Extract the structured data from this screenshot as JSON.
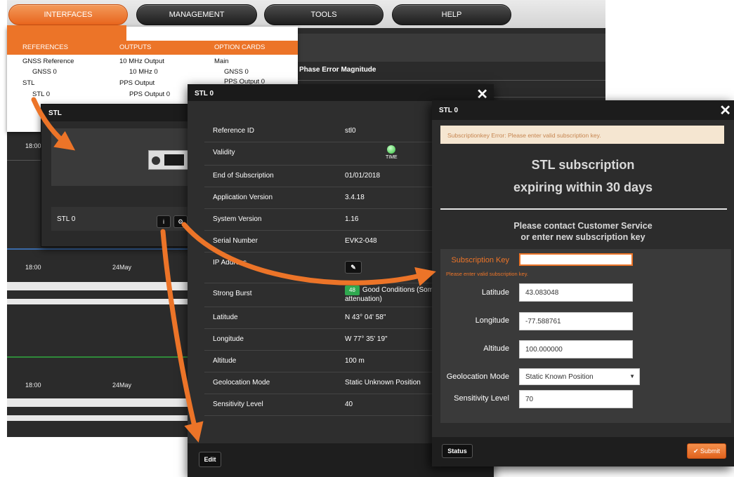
{
  "nav": {
    "items": [
      "INTERFACES",
      "MANAGEMENT",
      "TOOLS",
      "HELP"
    ]
  },
  "bg": {
    "phase_title": "Phase Error Magnitude",
    "ticks": [
      "18:00",
      "18:00",
      "24May",
      "18:00",
      "24May"
    ]
  },
  "dropdown": {
    "headers": [
      "REFERENCES",
      "OUTPUTS",
      "OPTION CARDS"
    ],
    "references": [
      "GNSS Reference",
      "GNSS 0",
      "STL",
      "STL 0"
    ],
    "outputs": [
      "10 MHz Output",
      "10 MHz 0",
      "PPS Output",
      "PPS Output 0"
    ],
    "option_cards": [
      "Main",
      "GNSS 0",
      "PPS Output 0"
    ]
  },
  "stl_window": {
    "title": "STL",
    "item_label": "STL 0",
    "info_icon": "info-icon",
    "settings_icon": "gear-icon"
  },
  "main_dialog": {
    "title": "STL 0",
    "close": "✕",
    "rows": [
      {
        "k": "Reference ID",
        "v": "stl0"
      },
      {
        "k": "Validity",
        "v": ""
      },
      {
        "k": "End of Subscription",
        "v": "01/01/2018"
      },
      {
        "k": "Application Version",
        "v": "3.4.18"
      },
      {
        "k": "System Version",
        "v": "1.16"
      },
      {
        "k": "Serial Number",
        "v": "EVK2-048"
      },
      {
        "k": "IP Address",
        "v": ""
      },
      {
        "k": "Strong Burst",
        "v": "Good Conditions (Some attenuation)"
      },
      {
        "k": "Latitude",
        "v": "N 43° 04' 58\""
      },
      {
        "k": "Longitude",
        "v": "W 77° 35' 19\""
      },
      {
        "k": "Altitude",
        "v": "100 m"
      },
      {
        "k": "Geolocation Mode",
        "v": "Static Unknown Position"
      },
      {
        "k": "Sensitivity Level",
        "v": "40"
      }
    ],
    "validity_led_label": "TIME",
    "strong_burst_badge": "48",
    "edit_label": "Edit"
  },
  "sub_dialog": {
    "title": "STL 0",
    "close": "✕",
    "error_text": "Subscriptionkey Error: Please enter valid subscription key.",
    "heading_line1": "STL subscription",
    "heading_line2": "expiring within 30 days",
    "contact_line1": "Please contact Customer Service",
    "contact_line2": "or enter new subscription key",
    "fields": {
      "subscription_key_label": "Subscription Key",
      "subscription_key_value": "",
      "subscription_key_hint": "Please enter valid subscription key.",
      "latitude_label": "Latitude",
      "latitude_value": "43.083048",
      "longitude_label": "Longitude",
      "longitude_value": "-77.588761",
      "altitude_label": "Altitude",
      "altitude_value": "100.000000",
      "geolocation_label": "Geolocation Mode",
      "geolocation_value": "Static Known Position",
      "sensitivity_label": "Sensitivity Level",
      "sensitivity_value": "70"
    },
    "status_label": "Status",
    "submit_label": "✔ Submit"
  },
  "colors": {
    "accent_orange": "#ec7428",
    "dark_bg": "#2c2c2c",
    "status_green": "#2fa84f"
  }
}
